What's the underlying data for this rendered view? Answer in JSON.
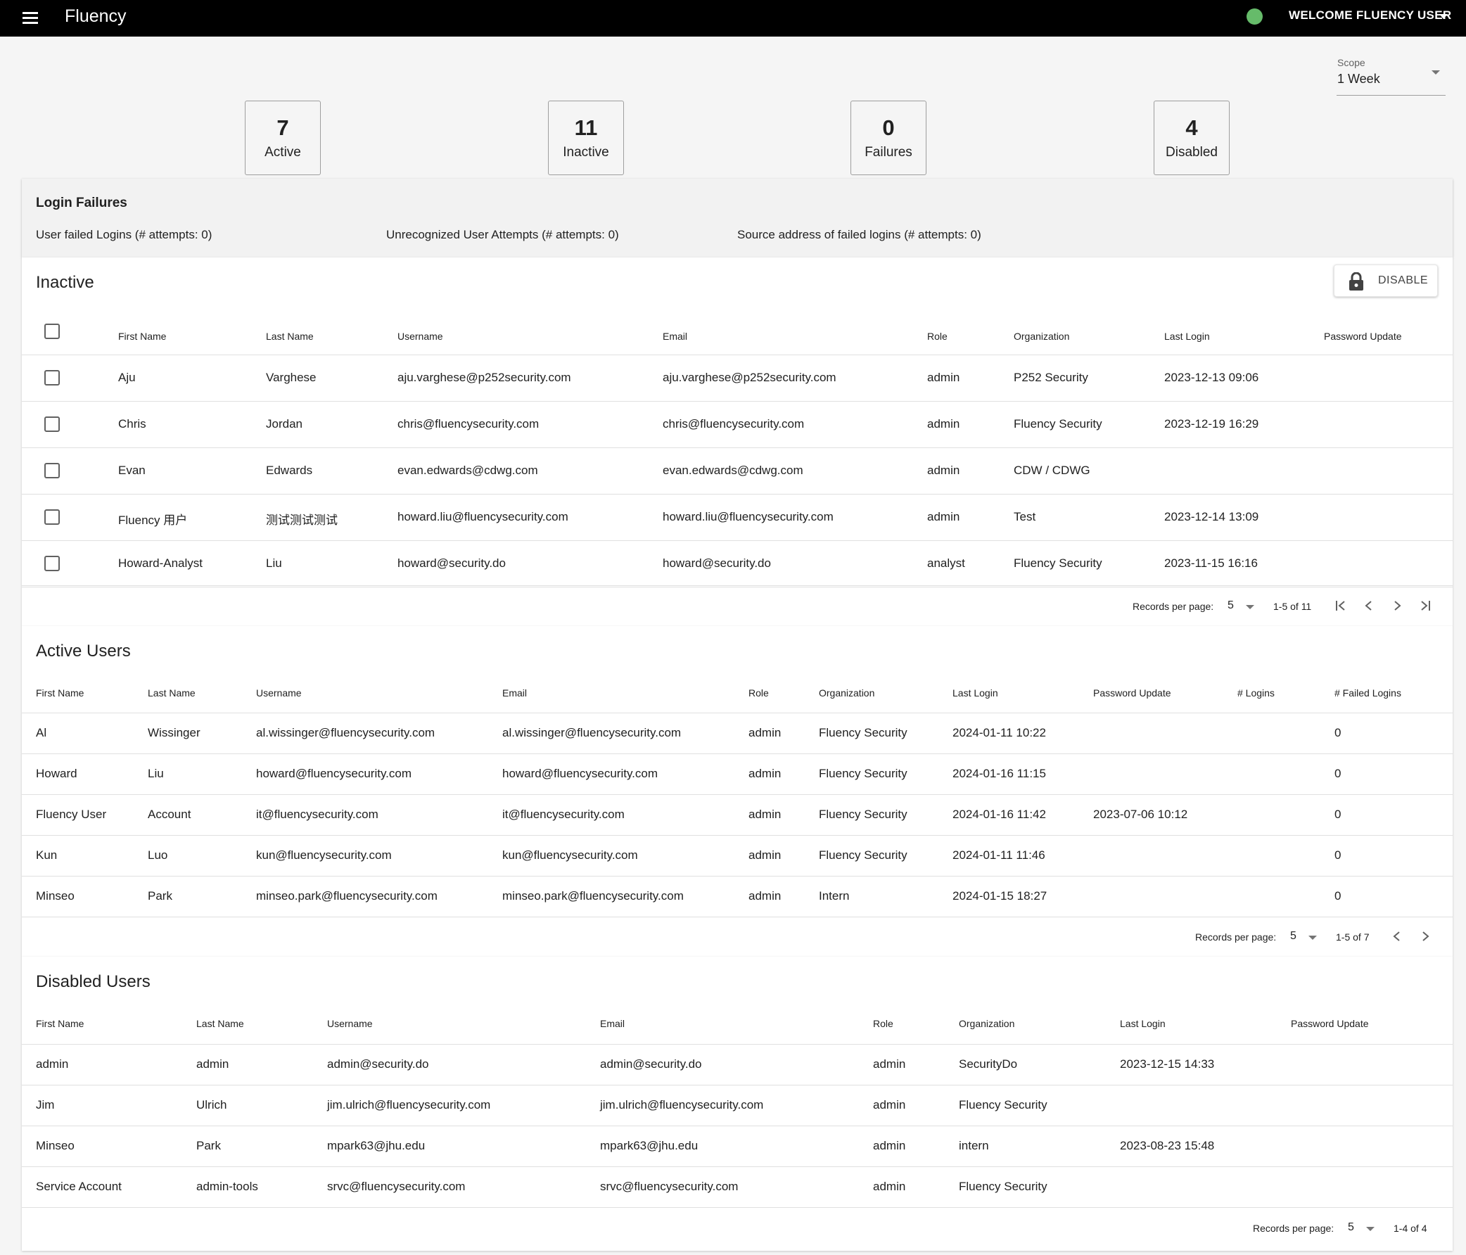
{
  "app": {
    "title": "Fluency",
    "welcome": "WELCOME FLUENCY USER",
    "status_color": "#66bb6a"
  },
  "scope": {
    "label": "Scope",
    "value": "1 Week"
  },
  "stats": [
    {
      "value": "7",
      "label": "Active"
    },
    {
      "value": "11",
      "label": "Inactive"
    },
    {
      "value": "0",
      "label": "Failures"
    },
    {
      "value": "4",
      "label": "Disabled"
    }
  ],
  "login_failures": {
    "title": "Login Failures",
    "items": [
      "User failed Logins (# attempts: 0)",
      "Unrecognized User Attempts (# attempts: 0)",
      "Source address of failed logins (# attempts: 0)"
    ]
  },
  "inactive": {
    "title": "Inactive",
    "disable_label": "DISABLE",
    "columns": [
      "First Name",
      "Last Name",
      "Username",
      "Email",
      "Role",
      "Organization",
      "Last Login",
      "Password Update"
    ],
    "rows": [
      [
        "Aju",
        "Varghese",
        "aju.varghese@p252security.com",
        "aju.varghese@p252security.com",
        "admin",
        "P252 Security",
        "2023-12-13 09:06",
        ""
      ],
      [
        "Chris",
        "Jordan",
        "chris@fluencysecurity.com",
        "chris@fluencysecurity.com",
        "admin",
        "Fluency Security",
        "2023-12-19 16:29",
        ""
      ],
      [
        "Evan",
        "Edwards",
        "evan.edwards@cdwg.com",
        "evan.edwards@cdwg.com",
        "admin",
        "CDW / CDWG",
        "",
        ""
      ],
      [
        "Fluency 用户",
        "测试测试测试",
        "howard.liu@fluencysecurity.com",
        "howard.liu@fluencysecurity.com",
        "admin",
        "Test",
        "2023-12-14 13:09",
        ""
      ],
      [
        "Howard-Analyst",
        "Liu",
        "howard@security.do",
        "howard@security.do",
        "analyst",
        "Fluency Security",
        "2023-11-15 16:16",
        ""
      ]
    ],
    "pager": {
      "label": "Records per page:",
      "per_page": "5",
      "range": "1-5 of 11"
    }
  },
  "active": {
    "title": "Active Users",
    "columns": [
      "First Name",
      "Last Name",
      "Username",
      "Email",
      "Role",
      "Organization",
      "Last Login",
      "Password Update",
      "# Logins",
      "# Failed Logins"
    ],
    "rows": [
      [
        "Al",
        "Wissinger",
        "al.wissinger@fluencysecurity.com",
        "al.wissinger@fluencysecurity.com",
        "admin",
        "Fluency Security",
        "2024-01-11 10:22",
        "",
        "",
        "0"
      ],
      [
        "Howard",
        "Liu",
        "howard@fluencysecurity.com",
        "howard@fluencysecurity.com",
        "admin",
        "Fluency Security",
        "2024-01-16 11:15",
        "",
        "",
        "0"
      ],
      [
        "Fluency User",
        "Account",
        "it@fluencysecurity.com",
        "it@fluencysecurity.com",
        "admin",
        "Fluency Security",
        "2024-01-16 11:42",
        "2023-07-06 10:12",
        "",
        "0"
      ],
      [
        "Kun",
        "Luo",
        "kun@fluencysecurity.com",
        "kun@fluencysecurity.com",
        "admin",
        "Fluency Security",
        "2024-01-11 11:46",
        "",
        "",
        "0"
      ],
      [
        "Minseo",
        "Park",
        "minseo.park@fluencysecurity.com",
        "minseo.park@fluencysecurity.com",
        "admin",
        "Intern",
        "2024-01-15 18:27",
        "",
        "",
        "0"
      ]
    ],
    "pager": {
      "label": "Records per page:",
      "per_page": "5",
      "range": "1-5 of 7"
    }
  },
  "disabled": {
    "title": "Disabled Users",
    "columns": [
      "First Name",
      "Last Name",
      "Username",
      "Email",
      "Role",
      "Organization",
      "Last Login",
      "Password Update"
    ],
    "rows": [
      [
        "admin",
        "admin",
        "admin@security.do",
        "admin@security.do",
        "admin",
        "SecurityDo",
        "2023-12-15 14:33",
        ""
      ],
      [
        "Jim",
        "Ulrich",
        "jim.ulrich@fluencysecurity.com",
        "jim.ulrich@fluencysecurity.com",
        "admin",
        "Fluency Security",
        "",
        ""
      ],
      [
        "Minseo",
        "Park",
        "mpark63@jhu.edu",
        "mpark63@jhu.edu",
        "admin",
        "intern",
        "2023-08-23 15:48",
        ""
      ],
      [
        "Service Account",
        "admin-tools",
        "srvc@fluencysecurity.com",
        "srvc@fluencysecurity.com",
        "admin",
        "Fluency Security",
        "",
        ""
      ]
    ],
    "pager": {
      "label": "Records per page:",
      "per_page": "5",
      "range": "1-4 of 4"
    }
  },
  "icons": {
    "menu": "hamburger-icon",
    "lock": "lock-icon",
    "first": "first-page-icon",
    "prev": "chevron-left-icon",
    "next": "chevron-right-icon",
    "last": "last-page-icon"
  }
}
